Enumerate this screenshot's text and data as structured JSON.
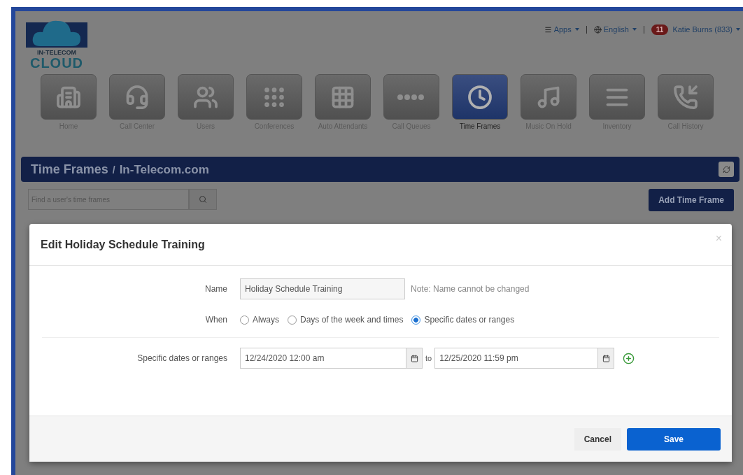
{
  "header": {
    "logo": {
      "line1": "IN-TELECOM",
      "line2": "CLOUD"
    },
    "apps": "Apps",
    "language": "English",
    "user": {
      "badge": "11",
      "name": "Katie Burns (833)"
    }
  },
  "nav": [
    {
      "label": "Home",
      "selected": false
    },
    {
      "label": "Call Center",
      "selected": false
    },
    {
      "label": "Users",
      "selected": false
    },
    {
      "label": "Conferences",
      "selected": false
    },
    {
      "label": "Auto Attendants",
      "selected": false
    },
    {
      "label": "Call Queues",
      "selected": false
    },
    {
      "label": "Time Frames",
      "selected": true
    },
    {
      "label": "Music On Hold",
      "selected": false
    },
    {
      "label": "Inventory",
      "selected": false
    },
    {
      "label": "Call History",
      "selected": false
    }
  ],
  "page_title": {
    "title": "Time Frames",
    "separator": "/",
    "domain": "In-Telecom.com"
  },
  "search": {
    "placeholder": "Find a user's time frames"
  },
  "add_button": "Add Time Frame",
  "modal": {
    "title": "Edit Holiday Schedule Training",
    "close": "×",
    "name": {
      "label": "Name",
      "value": "Holiday Schedule Training",
      "note": "Note: Name cannot be changed"
    },
    "when": {
      "label": "When",
      "options": [
        {
          "label": "Always",
          "selected": false
        },
        {
          "label": "Days of the week and times",
          "selected": false
        },
        {
          "label": "Specific dates or ranges",
          "selected": true
        }
      ]
    },
    "dates": {
      "label": "Specific dates or ranges",
      "start": "12/24/2020 12:00 am",
      "to": "to",
      "end": "12/25/2020 11:59 pm"
    },
    "buttons": {
      "cancel": "Cancel",
      "save": "Save"
    }
  }
}
